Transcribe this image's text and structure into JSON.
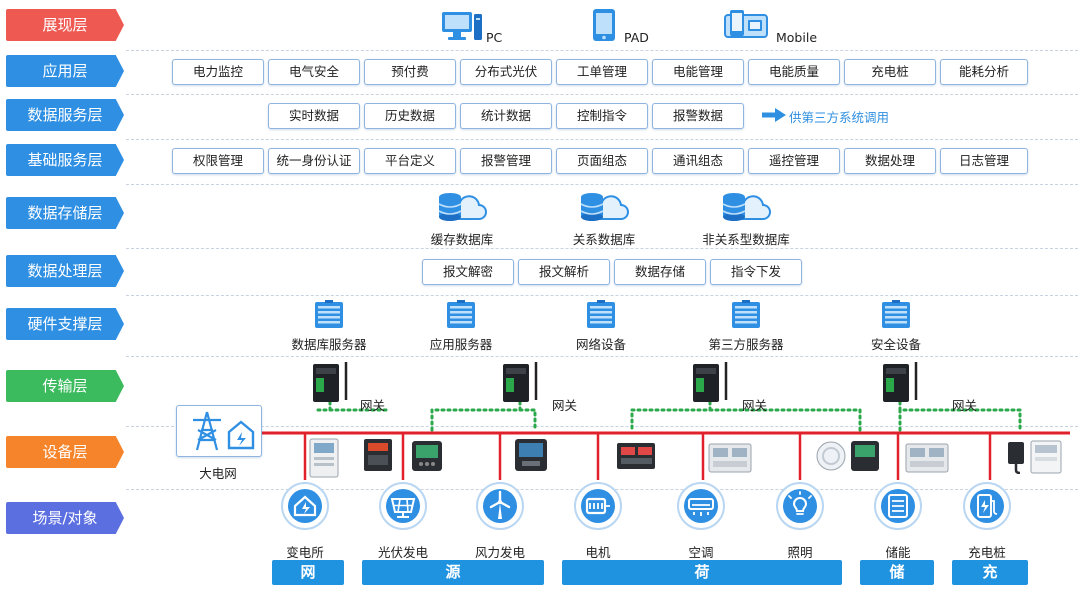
{
  "layers": [
    {
      "label": "展现层",
      "color": "#ee5a52"
    },
    {
      "label": "应用层",
      "color": "#2e8fe3"
    },
    {
      "label": "数据服务层",
      "color": "#2e8fe3"
    },
    {
      "label": "基础服务层",
      "color": "#2e8fe3"
    },
    {
      "label": "数据存储层",
      "color": "#2e8fe3"
    },
    {
      "label": "数据处理层",
      "color": "#2e8fe3"
    },
    {
      "label": "硬件支撑层",
      "color": "#2e8fe3"
    },
    {
      "label": "传输层",
      "color": "#3cba5e"
    },
    {
      "label": "设备层",
      "color": "#f5842a"
    },
    {
      "label": "场景/对象",
      "color": "#5c6fe0"
    }
  ],
  "presentation": {
    "pc": "PC",
    "pad": "PAD",
    "mobile": "Mobile"
  },
  "applications": [
    "电力监控",
    "电气安全",
    "预付费",
    "分布式光伏",
    "工单管理",
    "电能管理",
    "电能质量",
    "充电桩",
    "能耗分析"
  ],
  "data_services": {
    "items": [
      "实时数据",
      "历史数据",
      "统计数据",
      "控制指令",
      "报警数据"
    ],
    "note": "供第三方系统调用"
  },
  "base_services": [
    "权限管理",
    "统一身份认证",
    "平台定义",
    "报警管理",
    "页面组态",
    "通讯组态",
    "遥控管理",
    "数据处理",
    "日志管理"
  ],
  "storage": [
    "缓存数据库",
    "关系数据库",
    "非关系型数据库"
  ],
  "processing": [
    "报文解密",
    "报文解析",
    "数据存储",
    "指令下发"
  ],
  "hardware": [
    "数据库服务器",
    "应用服务器",
    "网络设备",
    "第三方服务器",
    "安全设备"
  ],
  "gateway_label": "网关",
  "grid_label": "大电网",
  "scenes": [
    "变电所",
    "光伏发电",
    "风力发电",
    "电机",
    "空调",
    "照明",
    "储能",
    "充电桩"
  ],
  "categories": [
    "网",
    "源",
    "荷",
    "储",
    "充"
  ],
  "colors": {
    "accent": "#2e8fe3",
    "bus": "#e0202a",
    "link": "#2aa84a",
    "category": "#1f92e0"
  }
}
